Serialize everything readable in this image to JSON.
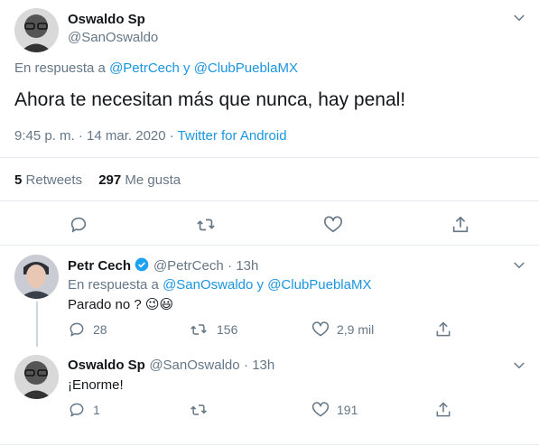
{
  "main_tweet": {
    "name": "Oswaldo Sp",
    "handle": "@SanOswaldo",
    "reply_prefix": "En respuesta a",
    "reply_to_1": "@PetrCech",
    "reply_and": "y",
    "reply_to_2": "@ClubPueblaMX",
    "text": "Ahora te necesitan más que nunca, hay penal!",
    "time": "9:45 p. m. · 14 mar. 2020 ·",
    "source": "Twitter for Android",
    "retweets_count": "5",
    "retweets_label": "Retweets",
    "likes_count": "297",
    "likes_label": "Me gusta"
  },
  "reply_1": {
    "name": "Petr Cech",
    "handle": "@PetrCech",
    "time": "· 13h",
    "reply_prefix": "En respuesta a",
    "reply_to_1": "@SanOswaldo",
    "reply_and": "y",
    "reply_to_2": "@ClubPueblaMX",
    "text": "Parado no ?",
    "emoji": "😉😃",
    "replies": "28",
    "retweets": "156",
    "likes": "2,9 mil"
  },
  "reply_2": {
    "name": "Oswaldo Sp",
    "handle": "@SanOswaldo",
    "time": "· 13h",
    "text": "¡Enorme!",
    "replies": "1",
    "retweets": "",
    "likes": "191"
  },
  "colors": {
    "link": "#1b95e0",
    "muted": "#657786",
    "text": "#14171a",
    "divider": "#e6ecf0",
    "verified": "#1da1f2"
  }
}
